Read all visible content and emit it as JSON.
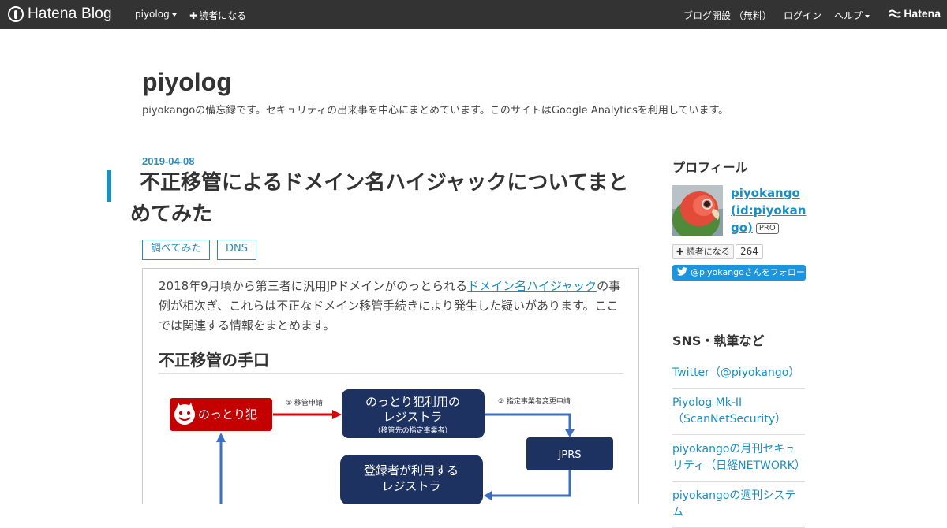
{
  "topbar": {
    "logo_text": "Hatena Blog",
    "blog_menu": "piyolog",
    "subscribe": "読者になる",
    "open_blog": "ブログ開設 （無料）",
    "login": "ログイン",
    "help": "ヘルプ",
    "hatena": "Hatena"
  },
  "blog": {
    "title": "piyolog",
    "description": "piyokangoの備忘録です。セキュリティの出来事を中心にまとめています。このサイトはGoogle Analyticsを利用しています。"
  },
  "entry": {
    "date": "2019-04-08",
    "title": "不正移管によるドメイン名ハイジャックについてまとめてみた",
    "categories": [
      "調べてみた",
      "DNS"
    ],
    "body_prefix": "2018年9月頃から第三者に汎用JPドメインがのっとられる",
    "body_link": "ドメイン名ハイジャック",
    "body_suffix": "の事例が相次ぎ、これらは不正なドメイン移管手続きにより発生した疑いがあります。ここでは関連する情報をまとめます。",
    "section_heading": "不正移管の手口"
  },
  "diagram": {
    "hijacker": "のっとり犯",
    "step1": "① 移管申請",
    "hijacker_registrar": "のっとり犯利用の",
    "hijacker_registrar_2": "レジストラ",
    "hijacker_registrar_sub": "（移管先の指定事業者）",
    "step2": "② 指定事業者変更申請",
    "jprs": "JPRS",
    "owner_registrar": "登録者が利用する",
    "owner_registrar_2": "レジストラ",
    "colors": {
      "red": "#c40000",
      "navy": "#1e3262",
      "arrow_blue": "#3a6fc4"
    }
  },
  "sidebar": {
    "profile_heading": "プロフィール",
    "profile_name": "piyokango (id:piyokango)",
    "pro_badge": "PRO",
    "reader_button": "読者になる",
    "reader_count": "264",
    "twitter_follow": "@piyokangoさんをフォロー",
    "sns_heading": "SNS・執筆など",
    "sns_items": [
      "Twitter（@piyokango）",
      "Piyolog Mk-II（ScanNetSecurity）",
      "piyokangoの月刊セキュリティ（日経NETWORK）",
      "piyokangoの週刊システム"
    ]
  }
}
